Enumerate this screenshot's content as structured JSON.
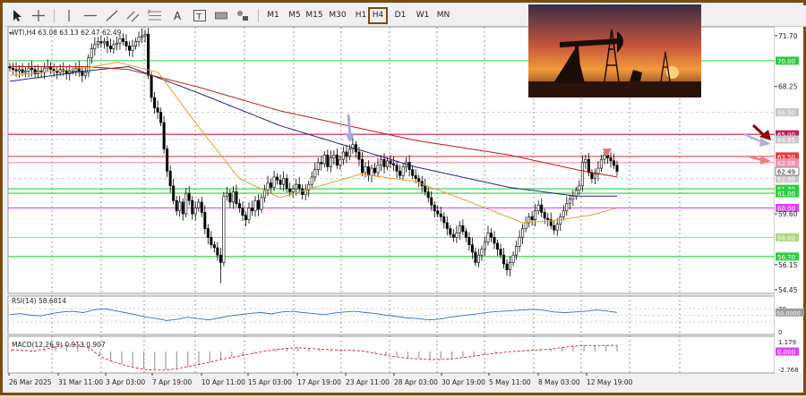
{
  "toolbar": {
    "timeframes": [
      "M1",
      "M5",
      "M15",
      "M30",
      "H1",
      "H4",
      "D1",
      "W1",
      "MN"
    ],
    "active_timeframe": "H4"
  },
  "chart_data": {
    "type": "candlestick",
    "symbol_header": "WTI,H4  63.08 63.13 62.47 62.49",
    "ylim": [
      54.2,
      72.3
    ],
    "price_ticks": [
      71.7,
      68.25,
      62.49,
      59.6,
      56.15,
      54.45
    ],
    "x_labels": [
      "26 Mar 2025",
      "31 Mar 11:00",
      "3 Apr 03:00",
      "7 Apr 19:00",
      "10 Apr 11:00",
      "15 Apr 03:00",
      "17 Apr 19:00",
      "23 Apr 11:00",
      "28 Apr 03:00",
      "30 Apr 19:00",
      "5 May 11:00",
      "8 May 03:00",
      "12 May 19:00"
    ],
    "current_price": 62.49,
    "levels": [
      {
        "label": "70.00",
        "price": 70.0,
        "color": "#2ecc40",
        "style": "solid"
      },
      {
        "label": "66.50",
        "price": 66.5,
        "color": "#c8c8c8",
        "style": "dash"
      },
      {
        "label": "65.00",
        "price": 65.0,
        "color": "#c2185b",
        "style": "solid"
      },
      {
        "label": "64.65",
        "price": 64.65,
        "color": "#c8c8c8",
        "style": "dash"
      },
      {
        "label": "63.50",
        "price": 63.5,
        "color": "#e53935",
        "style": "solid"
      },
      {
        "label": "63.08",
        "price": 63.08,
        "color": "#f48fb1",
        "style": "solid"
      },
      {
        "label": "62.00",
        "price": 62.0,
        "color": "#c8c8c8",
        "style": "dash"
      },
      {
        "label": "61.30",
        "price": 61.3,
        "color": "#2ecc40",
        "style": "solid"
      },
      {
        "label": "61.00",
        "price": 61.0,
        "color": "#2ecc40",
        "style": "solid"
      },
      {
        "label": "60.00",
        "price": 60.0,
        "color": "#e040fb",
        "style": "solid"
      },
      {
        "label": "58.00",
        "price": 58.0,
        "color": "#aed581",
        "style": "solid"
      },
      {
        "label": "56.70",
        "price": 56.7,
        "color": "#2ecc40",
        "style": "solid"
      }
    ],
    "closes": [
      69.5,
      69.4,
      69.3,
      69.4,
      69.2,
      69.3,
      69.5,
      69.4,
      69.1,
      69.3,
      69.2,
      69.5,
      69.6,
      69.4,
      69.3,
      69.2,
      69.4,
      69.3,
      69.1,
      69.3,
      69.3,
      69.5,
      69.3,
      69.0,
      69.2,
      70.2,
      70.8,
      71.1,
      71.3,
      71.2,
      71.3,
      71.0,
      70.8,
      71.1,
      71.2,
      71.5,
      71.3,
      71.0,
      70.7,
      71.0,
      71.3,
      71.6,
      71.7,
      71.8,
      69.0,
      67.5,
      66.8,
      66.5,
      65.8,
      64.0,
      62.5,
      61.5,
      60.5,
      59.8,
      60.4,
      59.6,
      61.0,
      60.5,
      59.6,
      60.0,
      60.4,
      59.7,
      58.6,
      58.0,
      57.5,
      57.3,
      56.8,
      56.3,
      60.8,
      61.0,
      60.4,
      61.1,
      60.3,
      60.0,
      59.5,
      59.2,
      60.0,
      59.8,
      60.5,
      59.9,
      60.7,
      61.2,
      61.7,
      61.4,
      62.1,
      61.9,
      61.6,
      62.0,
      61.3,
      61.1,
      61.3,
      61.6,
      61.3,
      60.9,
      61.2,
      61.6,
      62.1,
      62.6,
      63.1,
      63.0,
      63.6,
      62.8,
      63.4,
      63.6,
      62.9,
      63.3,
      63.8,
      63.5,
      64.0,
      64.3,
      63.8,
      63.3,
      62.4,
      62.8,
      62.2,
      62.7,
      62.4,
      62.9,
      63.3,
      62.8,
      63.2,
      63.0,
      62.9,
      62.5,
      62.2,
      62.8,
      63.1,
      62.6,
      62.2,
      62.0,
      61.8,
      61.5,
      61.1,
      60.7,
      60.2,
      59.8,
      59.6,
      59.4,
      59.0,
      58.6,
      58.2,
      58.0,
      58.3,
      58.8,
      58.4,
      58.0,
      57.5,
      57.0,
      56.3,
      56.8,
      57.2,
      57.7,
      58.3,
      58.0,
      57.6,
      57.2,
      56.8,
      56.2,
      55.8,
      56.3,
      56.8,
      57.4,
      58.0,
      58.6,
      59.0,
      59.4,
      59.2,
      59.8,
      60.2,
      59.7,
      59.3,
      59.2,
      58.8,
      58.5,
      58.9,
      59.4,
      59.8,
      60.3,
      60.6,
      60.8,
      61.2,
      61.5,
      63.1,
      63.3,
      62.4,
      62.0,
      62.3,
      62.7,
      63.3,
      63.6,
      63.4,
      63.2,
      62.9,
      62.49
    ],
    "ma_series": [
      {
        "color": "#1e2a78",
        "anchors": [
          [
            0,
            68.6
          ],
          [
            28,
            69.3
          ],
          [
            44,
            69.6
          ],
          [
            70,
            67.8
          ],
          [
            100,
            65.6
          ],
          [
            150,
            62.8
          ],
          [
            185,
            61.4
          ],
          [
            210,
            60.8
          ],
          [
            225,
            60.8
          ]
        ]
      },
      {
        "color": "#b71c1c",
        "anchors": [
          [
            0,
            69.6
          ],
          [
            28,
            69.6
          ],
          [
            44,
            69.4
          ],
          [
            70,
            68.2
          ],
          [
            100,
            66.6
          ],
          [
            150,
            64.6
          ],
          [
            185,
            63.6
          ],
          [
            210,
            62.6
          ],
          [
            225,
            62.1
          ]
        ]
      },
      {
        "color": "#e0a030",
        "anchors": [
          [
            0,
            69.0
          ],
          [
            28,
            69.5
          ],
          [
            40,
            69.9
          ],
          [
            55,
            69.2
          ],
          [
            70,
            65.5
          ],
          [
            85,
            62.0
          ],
          [
            100,
            60.7
          ],
          [
            130,
            62.3
          ],
          [
            150,
            61.8
          ],
          [
            165,
            60.8
          ],
          [
            190,
            59.0
          ],
          [
            200,
            59.1
          ],
          [
            215,
            59.5
          ],
          [
            225,
            60.0
          ]
        ]
      }
    ],
    "rsi": {
      "label": "RSI(14) 58.6814",
      "levels": [
        "70",
        "50.0000",
        "0"
      ],
      "values": [
        52,
        55,
        50,
        48,
        55,
        60,
        62,
        58,
        66,
        70,
        64,
        58,
        52,
        45,
        40,
        34,
        38,
        44,
        40,
        36,
        42,
        48,
        52,
        56,
        58,
        54,
        60,
        62,
        58,
        55,
        52,
        57,
        60,
        62,
        58,
        55,
        50,
        46,
        42,
        40,
        36,
        38,
        44,
        48,
        52,
        56,
        60,
        62,
        64,
        66,
        68,
        65,
        60,
        58,
        60,
        62,
        66,
        63,
        58.7
      ]
    },
    "macd": {
      "label": "MACD(12,26,9) 0.913 0.907",
      "ticks": [
        "1.179",
        "0.000",
        "-2.768"
      ],
      "values": [
        0.3,
        0.2,
        0.1,
        0.4,
        0.7,
        0.9,
        1.0,
        0.6,
        -0.6,
        -1.3,
        -1.8,
        -2.2,
        -2.5,
        -2.6,
        -2.6,
        -2.4,
        -2.1,
        -1.8,
        -1.5,
        -1.1,
        -0.8,
        -0.5,
        -0.2,
        0.1,
        0.3,
        0.5,
        0.6,
        0.5,
        0.4,
        0.3,
        0.2,
        0.2,
        0.1,
        -0.2,
        -0.5,
        -0.7,
        -0.9,
        -1.0,
        -1.1,
        -1.1,
        -1.0,
        -0.8,
        -0.6,
        -0.4,
        -0.2,
        0.0,
        0.1,
        0.2,
        0.3,
        0.4,
        0.6,
        0.8,
        0.9,
        0.9,
        0.9,
        0.91
      ]
    }
  }
}
